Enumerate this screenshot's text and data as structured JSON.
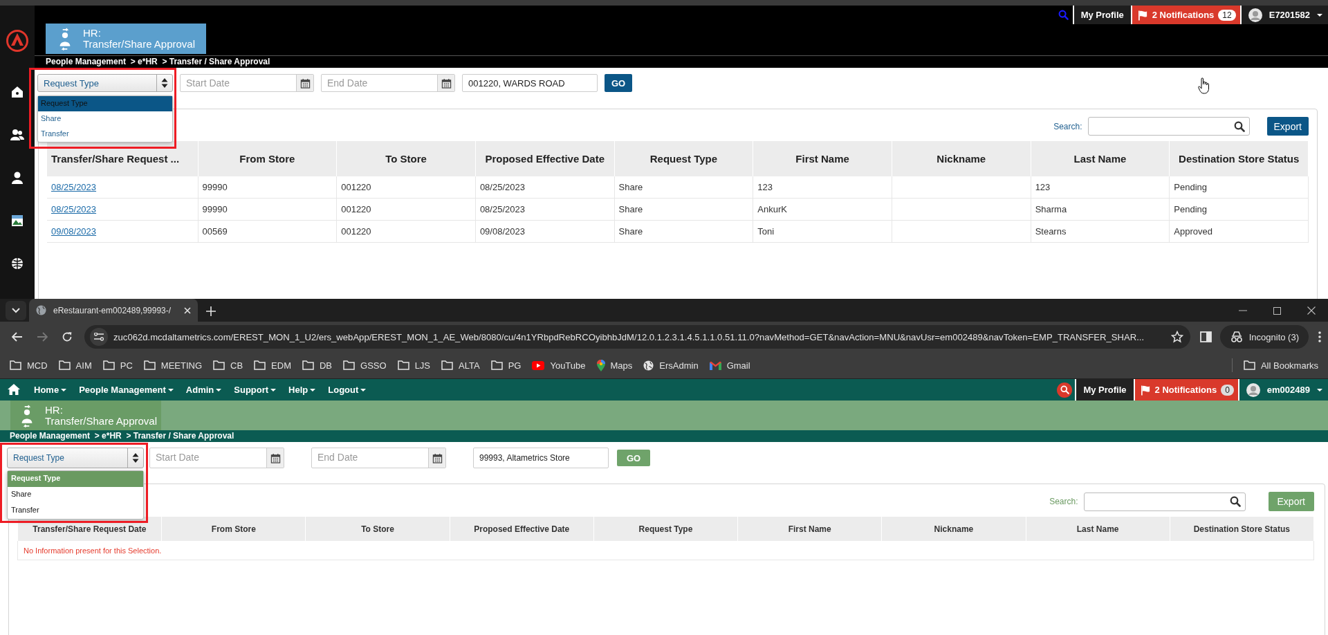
{
  "upper_app": {
    "top_nav": {
      "profile": "My Profile",
      "notifications": "2 Notifications",
      "notification_count": "12",
      "user": "E7201582"
    },
    "page_title": {
      "line_1": "HR:",
      "line_2": "Transfer/Share Approval"
    },
    "breadcrumb": "People Management  > e*HR  > Transfer / Share Approval",
    "filters": {
      "request_type": {
        "value": "Request Type",
        "options": [
          {
            "label": "Request Type",
            "selected": true
          },
          {
            "label": "Share",
            "selected": false
          },
          {
            "label": "Transfer",
            "selected": false
          }
        ]
      },
      "start_date": {
        "placeholder": "Start Date"
      },
      "end_date": {
        "placeholder": "End Date"
      },
      "store": {
        "value": "001220, WARDS ROAD"
      },
      "go_button": "GO"
    },
    "search": {
      "label": "Search:"
    },
    "export_button": "Export",
    "table": {
      "columns": [
        "Transfer/Share Request ...",
        "From Store",
        "To Store",
        "Proposed Effective Date",
        "Request Type",
        "First Name",
        "Nickname",
        "Last Name",
        "Destination Store Status"
      ],
      "rows": [
        {
          "cells": [
            "08/25/2023",
            "99990",
            "001220",
            "08/25/2023",
            "Share",
            "123",
            "",
            "123",
            "Pending"
          ]
        },
        {
          "cells": [
            "08/25/2023",
            "99990",
            "001220",
            "08/25/2023",
            "Share",
            "AnkurK",
            "",
            "Sharma",
            "Pending"
          ]
        },
        {
          "cells": [
            "09/08/2023",
            "00569",
            "001220",
            "09/08/2023",
            "Share",
            "Toni",
            "",
            "Stearns",
            "Approved"
          ]
        }
      ]
    }
  },
  "browser": {
    "tab_title": "eRestaurant-em002489,99993-/",
    "url": "zuc062d.mcdaltametrics.com/EREST_MON_1_U2/ers_webApp/EREST_MON_1_AE_Web/8080/cu/4n1YRbpdRebRCOyibhbJdM/12.0.1.2.3.1.4.5.1.1.0.51.11.0?navMethod=GET&navAction=MNU&navUsr=em002489&navToken=EMP_TRANSFER_SHAR...",
    "incognito": "Incognito (3)",
    "bookmarks": [
      {
        "label": "MCD",
        "kind": "folder"
      },
      {
        "label": "AIM",
        "kind": "folder"
      },
      {
        "label": "PC",
        "kind": "folder"
      },
      {
        "label": "MEETING",
        "kind": "folder"
      },
      {
        "label": "CB",
        "kind": "folder"
      },
      {
        "label": "EDM",
        "kind": "folder"
      },
      {
        "label": "DB",
        "kind": "folder"
      },
      {
        "label": "GSSO",
        "kind": "folder"
      },
      {
        "label": "LJS",
        "kind": "folder"
      },
      {
        "label": "ALTA",
        "kind": "folder"
      },
      {
        "label": "PG",
        "kind": "folder"
      },
      {
        "label": "YouTube",
        "kind": "video"
      },
      {
        "label": "Maps",
        "kind": "pin"
      },
      {
        "label": "ErsAdmin",
        "kind": "globe"
      },
      {
        "label": "Gmail",
        "kind": "mail"
      }
    ],
    "all_bookmarks": "All Bookmarks"
  },
  "lower_app": {
    "menu": [
      "Home",
      "People Management",
      "Admin",
      "Support",
      "Help",
      "Logout"
    ],
    "top_nav": {
      "profile": "My Profile",
      "notifications": "2 Notifications",
      "notification_count": "0",
      "user": "em002489"
    },
    "page_title": {
      "line_1": "HR:",
      "line_2": "Transfer/Share Approval"
    },
    "breadcrumb": "People Management  > e*HR  > Transfer / Share Approval",
    "filters": {
      "request_type": {
        "value": "Request Type",
        "options": [
          {
            "label": "Request Type",
            "selected": true
          },
          {
            "label": "Share",
            "selected": false
          },
          {
            "label": "Transfer",
            "selected": false
          }
        ]
      },
      "start_date": {
        "placeholder": "Start Date"
      },
      "end_date": {
        "placeholder": "End Date"
      },
      "store": {
        "value": "99993, Altametrics Store"
      },
      "go_button": "GO"
    },
    "search": {
      "label": "Search:"
    },
    "export_button": "Export",
    "table": {
      "columns": [
        "Transfer/Share Request Date",
        "From Store",
        "To Store",
        "Proposed Effective Date",
        "Request Type",
        "First Name",
        "Nickname",
        "Last Name",
        "Destination Store Status"
      ],
      "empty_message": "No Information present for this Selection."
    }
  }
}
